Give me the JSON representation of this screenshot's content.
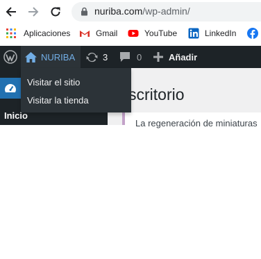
{
  "browser": {
    "url_host": "nuriba.com",
    "url_path": "/wp-admin/",
    "bookmarks": [
      {
        "label": "Aplicaciones",
        "icon": "apps-grid-icon"
      },
      {
        "label": "Gmail",
        "icon": "gmail-icon"
      },
      {
        "label": "YouTube",
        "icon": "youtube-icon"
      },
      {
        "label": "LinkedIn",
        "icon": "linkedin-icon"
      },
      {
        "label": "",
        "icon": "facebook-icon"
      }
    ]
  },
  "adminbar": {
    "site_name": "NURIBA",
    "updates_count": "3",
    "comments_count": "0",
    "new_label": "Añadir"
  },
  "site_menu": {
    "items": [
      "Visitar el sitio",
      "Visitar la tienda"
    ]
  },
  "sidebar": {
    "current_item": "Inicio"
  },
  "main": {
    "title": "scritorio",
    "notice": "La regeneración de miniaturas"
  },
  "colors": {
    "adminbar_bg": "#1d2327",
    "accent": "#2271b1",
    "site_link": "#72aee6"
  }
}
